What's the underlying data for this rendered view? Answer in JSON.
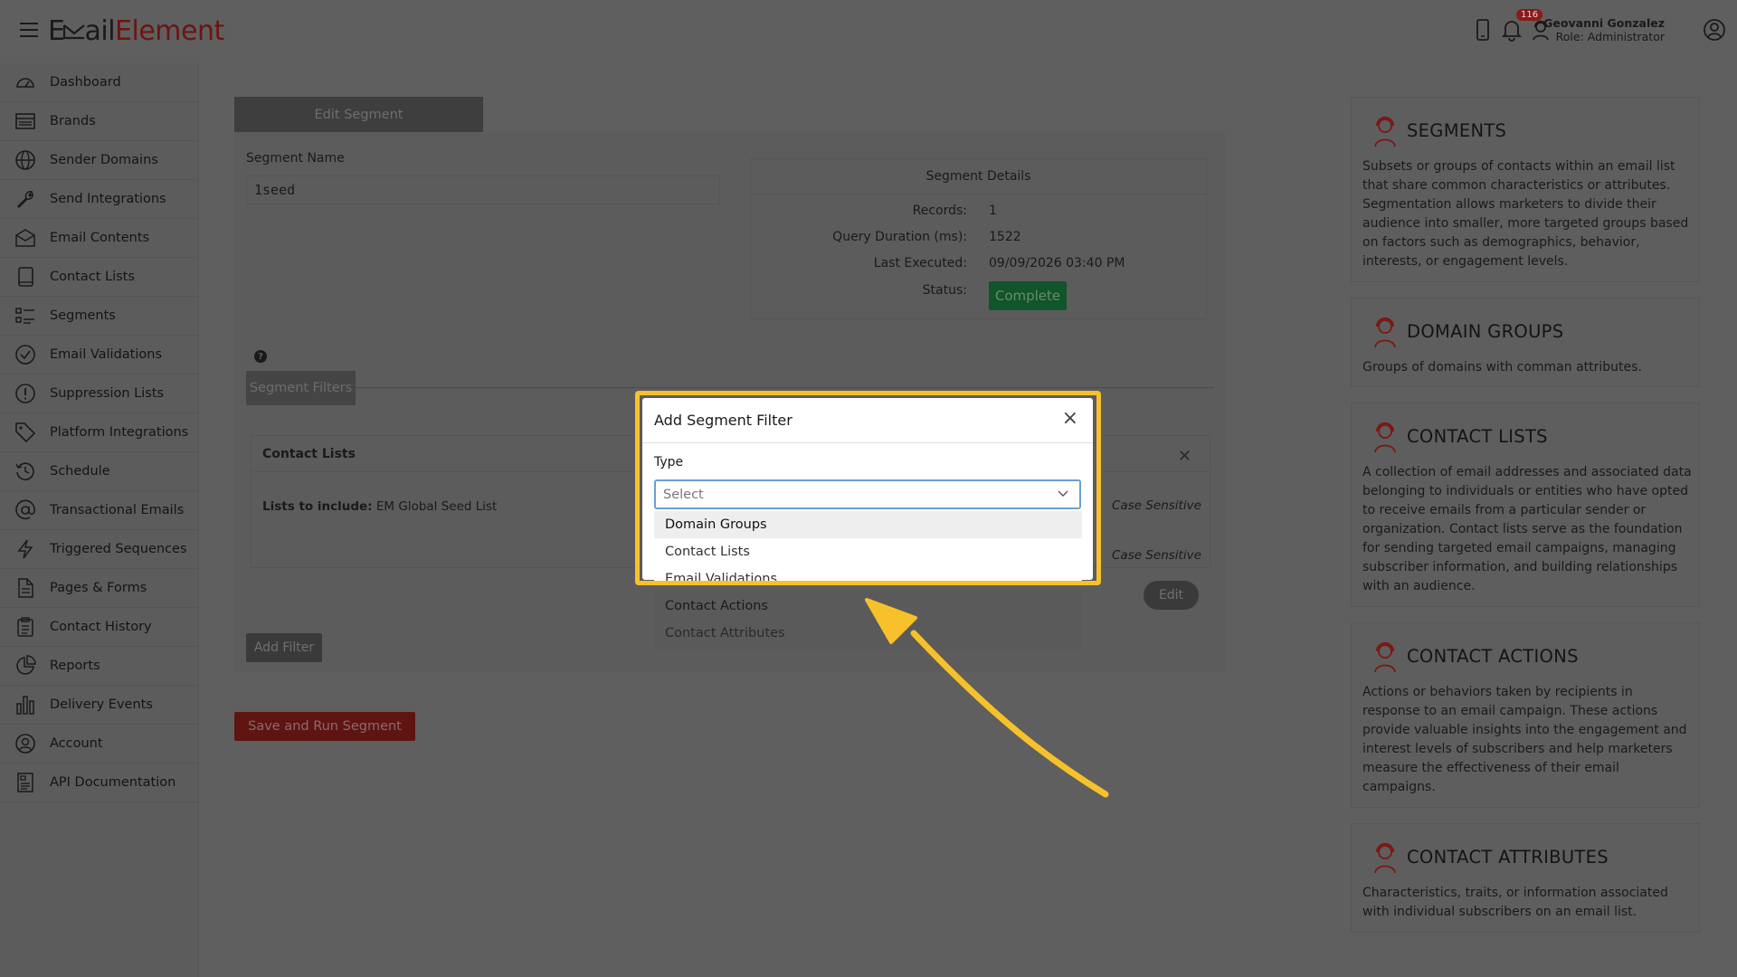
{
  "header": {
    "logo_part1": "E",
    "logo_part2": "ail",
    "logo_part3": "Element",
    "notifications_count": "116",
    "user_name": "Geovanni Gonzalez",
    "user_role": "Role: Administrator"
  },
  "sidebar": {
    "items": [
      {
        "label": "Dashboard",
        "icon": "dashboard-icon"
      },
      {
        "label": "Brands",
        "icon": "brands-icon"
      },
      {
        "label": "Sender Domains",
        "icon": "globe-icon"
      },
      {
        "label": "Send Integrations",
        "icon": "wrench-icon"
      },
      {
        "label": "Email Contents",
        "icon": "envelope-icon"
      },
      {
        "label": "Contact Lists",
        "icon": "book-icon"
      },
      {
        "label": "Segments",
        "icon": "list-icon"
      },
      {
        "label": "Email Validations",
        "icon": "check-circle-icon"
      },
      {
        "label": "Suppression Lists",
        "icon": "exclamation-circle-icon"
      },
      {
        "label": "Platform Integrations",
        "icon": "tag-icon"
      },
      {
        "label": "Schedule",
        "icon": "history-icon"
      },
      {
        "label": "Transactional Emails",
        "icon": "at-icon"
      },
      {
        "label": "Triggered Sequences",
        "icon": "lightning-icon"
      },
      {
        "label": "Pages & Forms",
        "icon": "document-icon"
      },
      {
        "label": "Contact History",
        "icon": "clipboard-icon"
      },
      {
        "label": "Reports",
        "icon": "pie-chart-icon"
      },
      {
        "label": "Delivery Events",
        "icon": "bar-chart-icon"
      },
      {
        "label": "Account",
        "icon": "user-circle-icon"
      },
      {
        "label": "API Documentation",
        "icon": "api-doc-icon"
      }
    ]
  },
  "main": {
    "tab_label": "Edit Segment",
    "segment_name_label": "Segment Name",
    "segment_name_value": "1seed",
    "details": {
      "title": "Segment Details",
      "records_label": "Records:",
      "records_value": "1",
      "duration_label": "Query Duration (ms):",
      "duration_value": "1522",
      "executed_label": "Last Executed:",
      "executed_value": "09/09/2026 03:40 PM",
      "status_label": "Status:",
      "status_value": "Complete"
    },
    "filters_tab": "Segment Filters",
    "contact_card": {
      "title": "Contact Lists",
      "include_label": "Lists to include:",
      "include_value": "EM Global Seed List",
      "case_sensitive_1": "Case Sensitive",
      "case_sensitive_2": "Case Sensitive",
      "edit_label": "Edit"
    },
    "add_filter_label": "Add Filter",
    "save_label": "Save and Run Segment"
  },
  "info": [
    {
      "title": "SEGMENTS",
      "desc": "Subsets or groups of contacts within an email list that share common characteristics or attributes. Segmentation allows marketers to divide their audience into smaller, more targeted groups based on factors such as demographics, behavior, interests, or engagement levels."
    },
    {
      "title": "DOMAIN GROUPS",
      "desc": "Groups of domains with comman attributes."
    },
    {
      "title": "CONTACT LISTS",
      "desc": "A collection of email addresses and associated data belonging to individuals or entities who have opted to receive emails from a particular sender or organization. Contact lists serve as the foundation for sending targeted email campaigns, managing subscriber information, and building relationships with an audience."
    },
    {
      "title": "CONTACT ACTIONS",
      "desc": "Actions or behaviors taken by recipients in response to an email campaign. These actions provide valuable insights into the engagement and interest levels of subscribers and help marketers measure the effectiveness of their email campaigns."
    },
    {
      "title": "CONTACT ATTRIBUTES",
      "desc": "Characteristics, traits, or information associated with individual subscribers on an email list."
    }
  ],
  "modal": {
    "title": "Add Segment Filter",
    "type_label": "Type",
    "select_placeholder": "Select",
    "options": [
      "Domain Groups",
      "Contact Lists",
      "Email Validations",
      "Contact Actions",
      "Contact Attributes"
    ]
  },
  "colors": {
    "highlight": "#f7c12b",
    "brand": "#6b1512",
    "status_complete": "#11552a"
  }
}
